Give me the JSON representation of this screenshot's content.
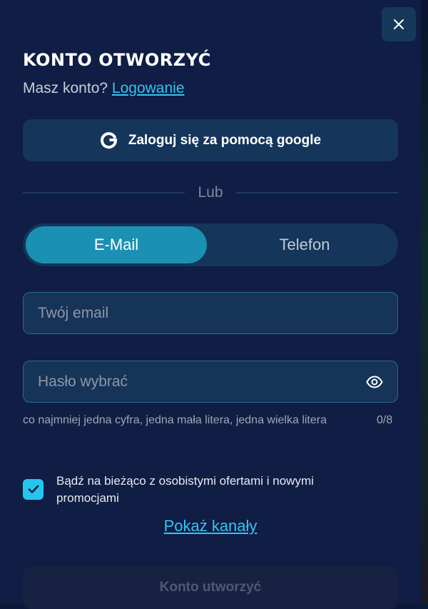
{
  "modal": {
    "title": "KONTO OTWORZYĆ",
    "have_account_text": "Masz konto?",
    "login_link": "Logowanie"
  },
  "google": {
    "label": "Zaloguj się za pomocą google"
  },
  "divider": {
    "text": "Lub"
  },
  "tabs": [
    {
      "label": "E-Mail",
      "active": true
    },
    {
      "label": "Telefon",
      "active": false
    }
  ],
  "email_field": {
    "placeholder": "Twój email",
    "value": ""
  },
  "password_field": {
    "placeholder": "Hasło wybrać",
    "value": ""
  },
  "password_hint": "co najmniej jedna cyfra, jedna mała litera, jedna wielka litera",
  "password_counter": "0/8",
  "newsletter": {
    "checked": true,
    "label": "Bądź na bieżąco z osobistymi ofertami i nowymi promocjami"
  },
  "show_channels_link": "Pokaż kanały",
  "submit_button": "Konto utworzyć",
  "colors": {
    "background": "#101d44",
    "accent": "#35c4f0",
    "active_tab": "#1b90b2",
    "checkbox": "#25c6ee"
  },
  "icons": {
    "close": "close-icon",
    "google": "google-icon",
    "eye": "eye-icon",
    "check": "check-icon"
  }
}
